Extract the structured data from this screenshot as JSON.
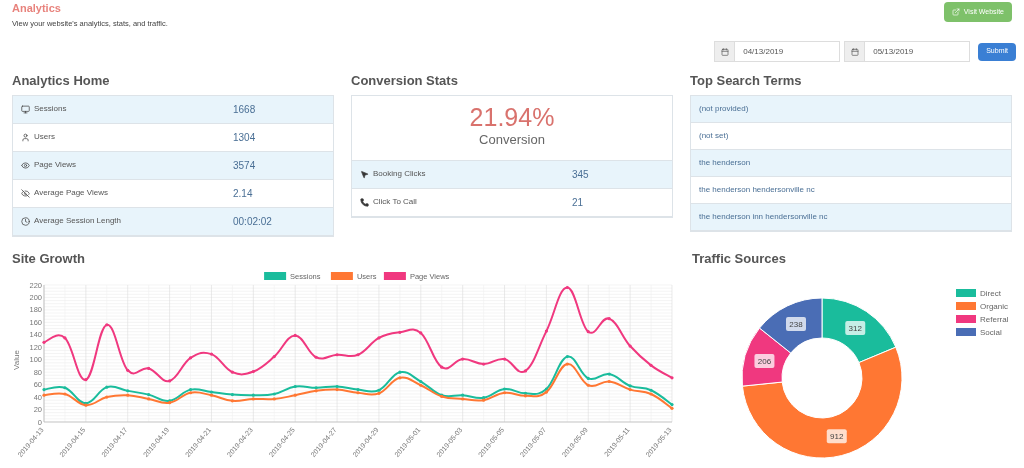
{
  "header": {
    "title": "Analytics",
    "subtitle": "View your website's analytics, stats, and traffic.",
    "visit_button": "Visit Website"
  },
  "date_range": {
    "start": "04/13/2019",
    "end": "05/13/2019",
    "submit": "Submit"
  },
  "analytics_home": {
    "title": "Analytics Home",
    "rows": [
      {
        "kind": "sessions",
        "label": "Sessions",
        "value": "1668"
      },
      {
        "kind": "users",
        "label": "Users",
        "value": "1304"
      },
      {
        "kind": "page_views",
        "label": "Page Views",
        "value": "3574"
      },
      {
        "kind": "average_page_views",
        "label": "Average Page Views",
        "value": "2.14"
      },
      {
        "kind": "session_length",
        "label": "Average Session Length",
        "value": "00:02:02"
      }
    ]
  },
  "conversion_stats": {
    "title": "Conversion Stats",
    "rate": "21.94%",
    "rate_label": "Conversion",
    "rows": [
      {
        "kind": "booking",
        "label": "Booking Clicks",
        "value": "345"
      },
      {
        "kind": "call",
        "label": "Click To Call",
        "value": "21"
      }
    ]
  },
  "top_search_terms": {
    "title": "Top Search Terms",
    "terms": [
      "(not provided)",
      "(not set)",
      "the henderson",
      "the henderson hendersonville nc",
      "the henderson inn hendersonville nc"
    ]
  },
  "site_growth": {
    "title": "Site Growth",
    "chart_data": {
      "type": "line",
      "ylabel": "Value",
      "ylim": [
        0,
        220
      ],
      "yticks": [
        0,
        20,
        40,
        60,
        80,
        100,
        120,
        140,
        160,
        180,
        200,
        220
      ],
      "grid": true,
      "legend": true,
      "categories": [
        "2019-04-13",
        null,
        "2019-04-15",
        null,
        "2019-04-17",
        null,
        "2019-04-19",
        null,
        "2019-04-21",
        null,
        "2019-04-23",
        null,
        "2019-04-25",
        null,
        "2019-04-27",
        null,
        "2019-04-29",
        null,
        "2019-05-01",
        null,
        "2019-05-03",
        null,
        "2019-05-05",
        null,
        "2019-05-07",
        null,
        "2019-05-09",
        null,
        "2019-05-11",
        null,
        "2019-05-13"
      ],
      "series": [
        {
          "name": "Sessions",
          "color": "#1abc9c",
          "values": [
            52,
            55,
            30,
            56,
            50,
            44,
            34,
            52,
            48,
            44,
            43,
            45,
            57,
            55,
            57,
            52,
            51,
            80,
            65,
            43,
            43,
            39,
            53,
            46,
            53,
            105,
            70,
            77,
            58,
            51,
            28
          ]
        },
        {
          "name": "Users",
          "color": "#ff7733",
          "values": [
            43,
            45,
            27,
            40,
            43,
            37,
            31,
            47,
            43,
            34,
            37,
            37,
            43,
            50,
            52,
            47,
            46,
            71,
            59,
            41,
            37,
            35,
            47,
            42,
            48,
            93,
            59,
            65,
            52,
            45,
            22
          ]
        },
        {
          "name": "Page Views",
          "color": "#f0387f",
          "values": [
            128,
            135,
            68,
            156,
            83,
            86,
            66,
            103,
            109,
            80,
            81,
            105,
            139,
            104,
            108,
            108,
            135,
            144,
            143,
            88,
            101,
            93,
            101,
            82,
            146,
            216,
            145,
            166,
            122,
            91,
            71
          ]
        }
      ]
    }
  },
  "traffic_sources": {
    "title": "Traffic Sources",
    "chart_data": {
      "type": "donut",
      "categories": [
        "Direct",
        "Organic",
        "Referral",
        "Social"
      ],
      "values": [
        312,
        912,
        206,
        238
      ],
      "colors": [
        "#1abc9c",
        "#ff7733",
        "#f0387f",
        "#4a6db5"
      ],
      "data_labels": true,
      "legend": true
    }
  }
}
